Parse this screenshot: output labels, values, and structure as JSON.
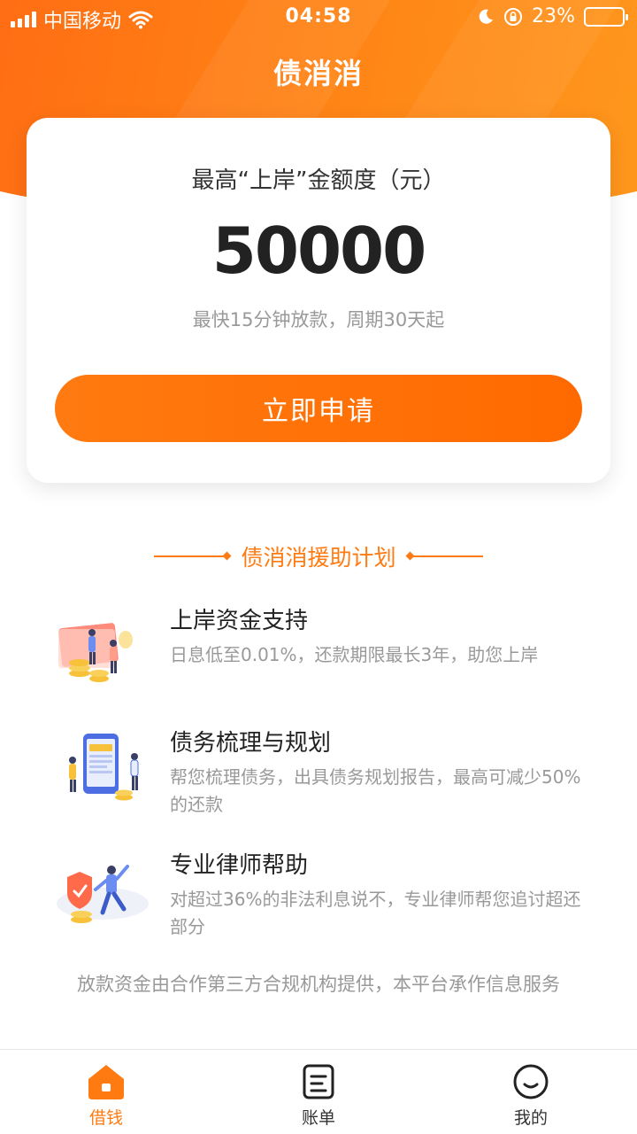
{
  "status_bar": {
    "carrier": "中国移动",
    "time": "04:58",
    "battery": "23%",
    "battery_level": 0.23
  },
  "header": {
    "title": "债消消"
  },
  "card": {
    "label": "最高“上岸”金额度（元）",
    "amount": "50000",
    "subtitle": "最快15分钟放款，周期30天起",
    "apply_button": "立即申请"
  },
  "section": {
    "title": "债消消援助计划"
  },
  "features": [
    {
      "title": "上岸资金支持",
      "desc": "日息低至0.01%，还款期限最长3年，助您上岸",
      "icon": "money-support-illustration"
    },
    {
      "title": "债务梳理与规划",
      "desc": "帮您梳理债务，出具债务规划报告，最高可减少50%的还款",
      "icon": "debt-planning-illustration"
    },
    {
      "title": "专业律师帮助",
      "desc": "对超过36%的非法利息说不，专业律师帮您追讨超还部分",
      "icon": "lawyer-help-illustration"
    }
  ],
  "footnote": "放款资金由合作第三方合规机构提供，本平台承作信息服务",
  "tabs": [
    {
      "label": "借钱",
      "icon": "home-icon",
      "active": true
    },
    {
      "label": "账单",
      "icon": "bill-icon",
      "active": false
    },
    {
      "label": "我的",
      "icon": "smile-icon",
      "active": false
    }
  ],
  "colors": {
    "accent": "#ff7a10",
    "text": "#222222",
    "muted": "#999999"
  }
}
